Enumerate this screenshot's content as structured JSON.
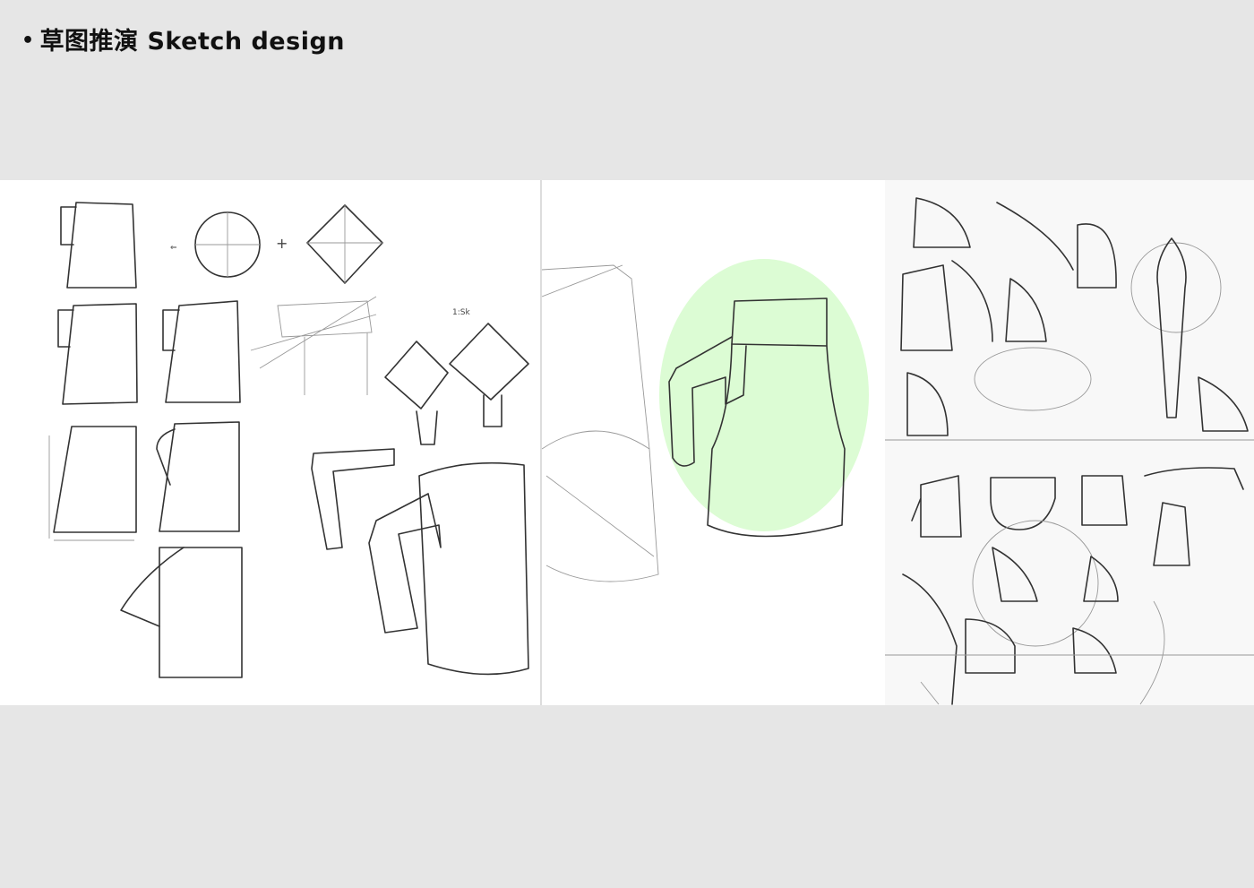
{
  "header": {
    "bullet": "•",
    "title": "草图推演  Sketch design"
  },
  "colors": {
    "background": "#e6e6e6",
    "highlight": "#dcfcd4"
  },
  "sketches": [
    {
      "name": "form-derivation-sketches"
    },
    {
      "name": "selected-concept-sketch"
    },
    {
      "name": "exploration-sketches"
    }
  ]
}
